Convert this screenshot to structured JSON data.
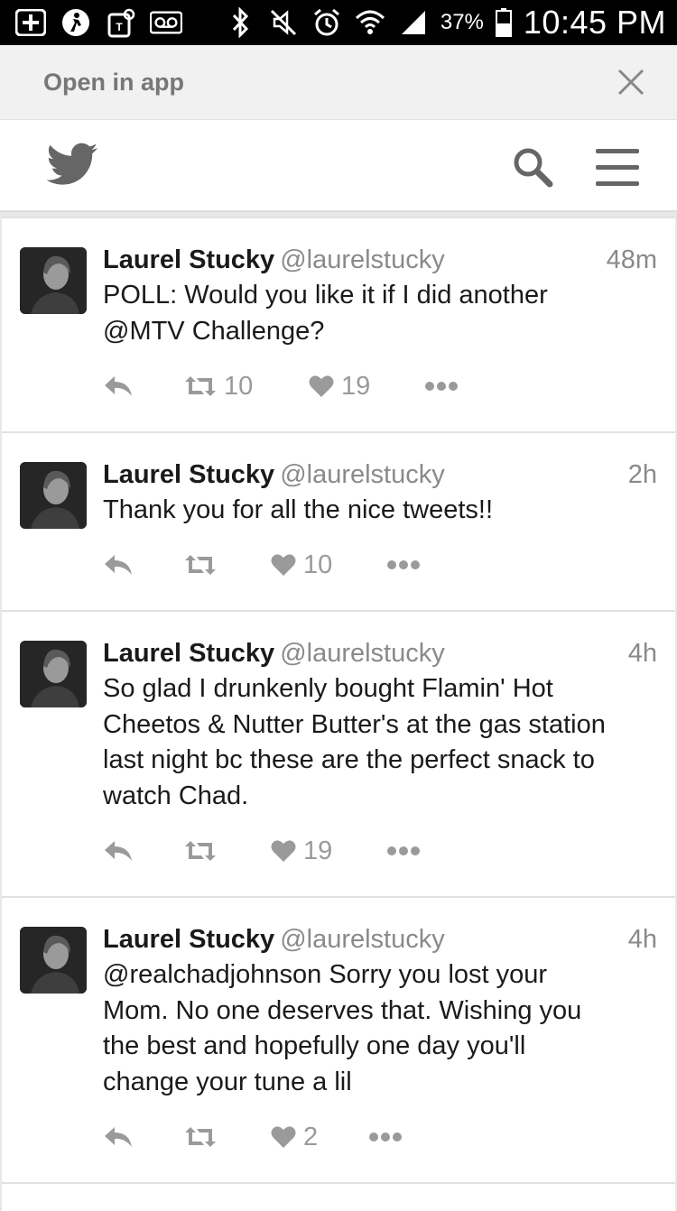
{
  "status_bar": {
    "battery_percent": "37%",
    "time": "10:45 PM"
  },
  "banner": {
    "label": "Open in app"
  },
  "header": {
    "icons": [
      "twitter-bird-icon",
      "search-icon",
      "menu-icon"
    ]
  },
  "tweets": [
    {
      "name": "Laurel Stucky",
      "handle": "@laurelstucky",
      "time": "48m",
      "lines": [
        "POLL: Would you like it if I did another",
        "@MTV Challenge?"
      ],
      "retweets": "10",
      "likes": "19"
    },
    {
      "name": "Laurel Stucky",
      "handle": "@laurelstucky",
      "time": "2h",
      "lines": [
        "Thank you for all the nice tweets!!"
      ],
      "retweets": "",
      "likes": "10"
    },
    {
      "name": "Laurel Stucky",
      "handle": "@laurelstucky",
      "time": "4h",
      "lines": [
        "So glad I drunkenly bought Flamin' Hot",
        "Cheetos & Nutter Butter's at the gas station",
        "last night bc these are the perfect snack to",
        "watch Chad."
      ],
      "retweets": "",
      "likes": "19"
    },
    {
      "name": "Laurel Stucky",
      "handle": "@laurelstucky",
      "time": "4h",
      "lines": [
        "@realchadjohnson Sorry you lost your",
        "Mom. No one deserves that. Wishing you",
        "the best and hopefully one day you'll",
        "change your tune a lil"
      ],
      "retweets": "",
      "likes": "2"
    }
  ]
}
